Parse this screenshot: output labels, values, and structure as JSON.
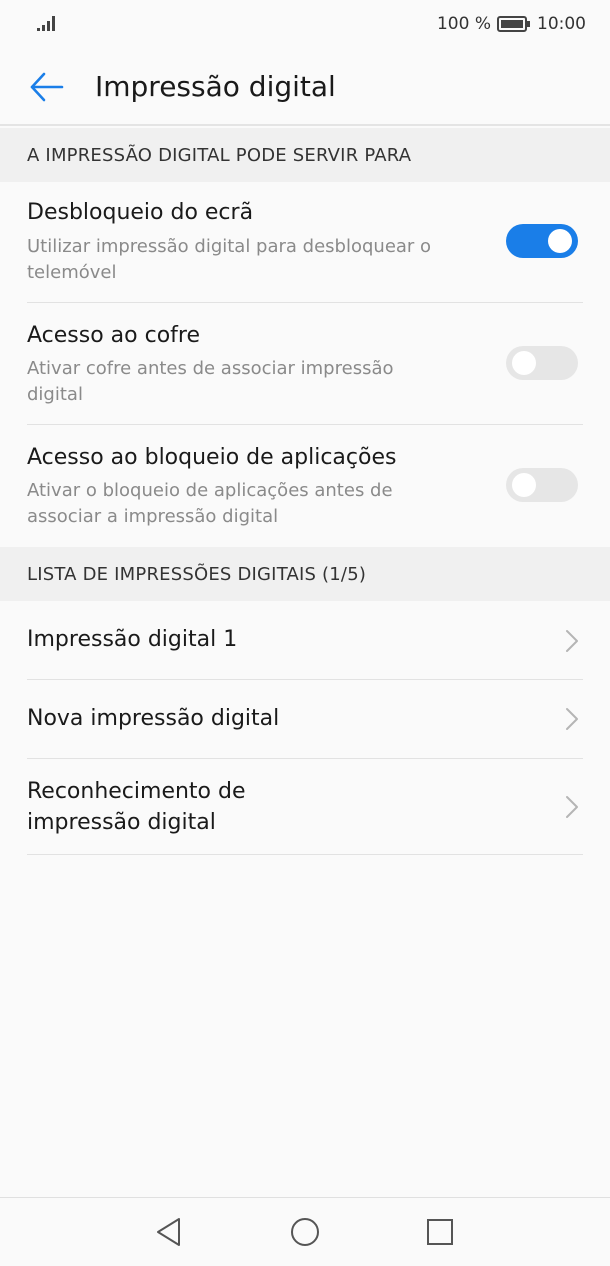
{
  "status_bar": {
    "battery_percent": "100 %",
    "time": "10:00",
    "battery_level": 1.0
  },
  "app_bar": {
    "title": "Impressão digital",
    "back_icon": "arrow-left-icon"
  },
  "sections": {
    "uses": {
      "header": "A IMPRESSÃO DIGITAL PODE SERVIR PARA",
      "items": [
        {
          "title": "Desbloqueio do ecrã",
          "subtitle_line1": "Utilizar impressão digital para desbloquear o",
          "subtitle_line2": "telemóvel",
          "enabled": true
        },
        {
          "title": "Acesso ao cofre",
          "subtitle_line1": "Ativar cofre antes de associar impressão",
          "subtitle_line2": "digital",
          "enabled": false
        },
        {
          "title": "Acesso ao bloqueio de aplicações",
          "subtitle_line1": "Ativar o bloqueio de aplicações antes de",
          "subtitle_line2": "associar a impressão digital",
          "enabled": false
        }
      ]
    },
    "list": {
      "header": "LISTA DE IMPRESSÕES DIGITAIS (1/5)",
      "items": [
        {
          "title_line1": "Impressão digital 1"
        },
        {
          "title_line1": "Nova impressão digital"
        },
        {
          "title_line1": "Reconhecimento de",
          "title_line2": "impressão digital"
        }
      ]
    }
  },
  "colors": {
    "accent": "#1a7ee8",
    "toggle_off": "#e6e6e6",
    "section_bg": "#f0f0f0",
    "background": "#fafafa"
  },
  "nav_bar": {
    "icons": [
      "triangle-back-icon",
      "circle-home-icon",
      "square-recents-icon"
    ]
  }
}
